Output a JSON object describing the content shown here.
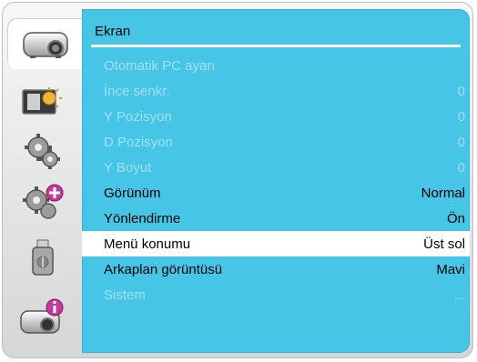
{
  "sidebar": {
    "tabs": [
      {
        "icon": "projector-icon",
        "active": true
      },
      {
        "icon": "image-brightness-icon",
        "active": false
      },
      {
        "icon": "gear-icon",
        "active": false
      },
      {
        "icon": "gear-plus-icon",
        "active": false
      },
      {
        "icon": "usb-drive-icon",
        "active": false
      },
      {
        "icon": "projector-info-icon",
        "active": false
      }
    ]
  },
  "panel": {
    "title": "Ekran",
    "rows": [
      {
        "label": "Otomatik PC ayarı",
        "value": "",
        "state": "disabled"
      },
      {
        "label": "İnce senkr.",
        "value": "0",
        "state": "disabled"
      },
      {
        "label": "Y Pozisyon",
        "value": "0",
        "state": "disabled"
      },
      {
        "label": "D Pozisyon",
        "value": "0",
        "state": "disabled"
      },
      {
        "label": "Y Boyut",
        "value": "0",
        "state": "disabled"
      },
      {
        "label": "Görünüm",
        "value": "Normal",
        "state": "enabled"
      },
      {
        "label": "Yönlendirme",
        "value": "Ön",
        "state": "enabled"
      },
      {
        "label": "Menü konumu",
        "value": "Üst sol",
        "state": "selected"
      },
      {
        "label": "Arkaplan görüntüsü",
        "value": "Mavi",
        "state": "enabled"
      },
      {
        "label": "Sistem",
        "value": "...",
        "state": "disabled"
      }
    ]
  },
  "colors": {
    "panel": "#47c5e6",
    "disabled_text": "#a4dff0",
    "selected_bg": "#ffffff"
  }
}
